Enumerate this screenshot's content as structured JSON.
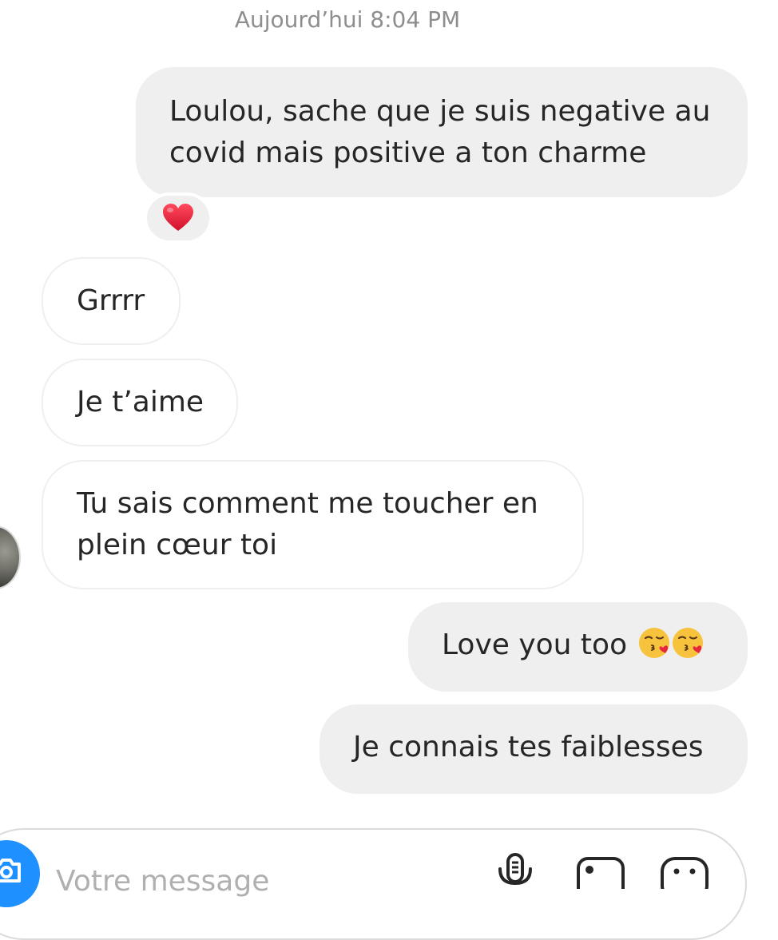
{
  "conversation": {
    "timestamp": "Aujourd’hui 8:04 PM",
    "messages": [
      {
        "id": "msg-1",
        "direction": "sent",
        "lines": [
          "Loulou, sache que je suis negative au",
          "covid mais positive a ton charme"
        ]
      },
      {
        "id": "msg-2",
        "direction": "received",
        "lines": [
          "Grrrr"
        ]
      },
      {
        "id": "msg-3",
        "direction": "received",
        "lines": [
          "Je t’aime"
        ]
      },
      {
        "id": "msg-4",
        "direction": "received",
        "lines": [
          "Tu sais comment me toucher en",
          "plein cœur toi"
        ]
      },
      {
        "id": "msg-5",
        "direction": "sent",
        "lines": [
          "Love you too "
        ],
        "emoji": [
          "face-blowing-a-kiss",
          "face-blowing-a-kiss"
        ]
      },
      {
        "id": "msg-6",
        "direction": "sent",
        "lines": [
          "Je connais tes faiblesses"
        ]
      }
    ],
    "reaction": {
      "message_id": "msg-1",
      "icon": "red-heart-icon"
    }
  },
  "composer": {
    "placeholder": "Votre message",
    "value": "",
    "icons": [
      "camera-icon",
      "microphone-icon",
      "gallery-icon",
      "sticker-icon"
    ]
  },
  "colors": {
    "sent_bubble": "#efefef",
    "received_border": "#efefef",
    "timestamp_text": "#8e8e8e",
    "camera_button": "#1e90ff",
    "heart": "#ed1c3c"
  }
}
